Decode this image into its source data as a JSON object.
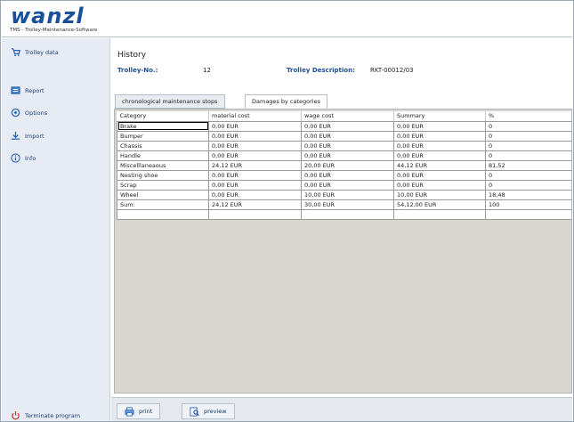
{
  "header": {
    "logo": "wanzl",
    "subtitle": "TMS - Trolley-Maintenance-Software"
  },
  "sidebar": {
    "items": [
      {
        "label": "Trolley data",
        "icon": "trolley-icon"
      },
      {
        "label": "Report",
        "icon": "report-icon"
      },
      {
        "label": "Options",
        "icon": "options-icon"
      },
      {
        "label": "Import",
        "icon": "import-icon"
      },
      {
        "label": "Info",
        "icon": "info-icon"
      }
    ],
    "terminate": {
      "label": "Terminate program",
      "icon": "power-icon"
    }
  },
  "main": {
    "title": "History",
    "trolley_no_label": "Trolley-No.:",
    "trolley_no": "12",
    "description_label": "Trolley Description:",
    "description": "RKT-00012/03",
    "tabs": [
      {
        "label": "chronological maintenance stops",
        "active": false
      },
      {
        "label": "Damages by categories",
        "active": true
      }
    ],
    "table": {
      "headers": [
        "Category",
        "material cost",
        "wage cost",
        "Summary",
        "%"
      ],
      "rows": [
        [
          "Brake",
          "0,00 EUR",
          "0,00 EUR",
          "0,00 EUR",
          "0"
        ],
        [
          "Bumper",
          "0,00 EUR",
          "0,00 EUR",
          "0,00 EUR",
          "0"
        ],
        [
          "Chassis",
          "0,00 EUR",
          "0,00 EUR",
          "0,00 EUR",
          "0"
        ],
        [
          "Handle",
          "0,00 EUR",
          "0,00 EUR",
          "0,00 EUR",
          "0"
        ],
        [
          "Miscelllaneaous",
          "24,12 EUR",
          "20,00 EUR",
          "44,12 EUR",
          "81,52"
        ],
        [
          "Nesting shoe",
          "0,00 EUR",
          "0,00 EUR",
          "0,00 EUR",
          "0"
        ],
        [
          "Scrap",
          "0,00 EUR",
          "0,00 EUR",
          "0,00 EUR",
          "0"
        ],
        [
          "Wheel",
          "0,00 EUR",
          "10,00 EUR",
          "10,00 EUR",
          "18,48"
        ],
        [
          "Sum:",
          "24,12 EUR",
          "30,00 EUR",
          "54,12,00 EUR",
          "100"
        ],
        [
          "",
          "",
          "",
          "",
          ""
        ]
      ]
    }
  },
  "footer": {
    "print_label": "print",
    "preview_label": "preview"
  },
  "colors": {
    "brand": "#1a4f9c",
    "label_blue": "#1f4e97",
    "sidebar_bg": "#e7ecf4",
    "panel_bg": "#d9d5cf",
    "power_red": "#d9342b"
  }
}
